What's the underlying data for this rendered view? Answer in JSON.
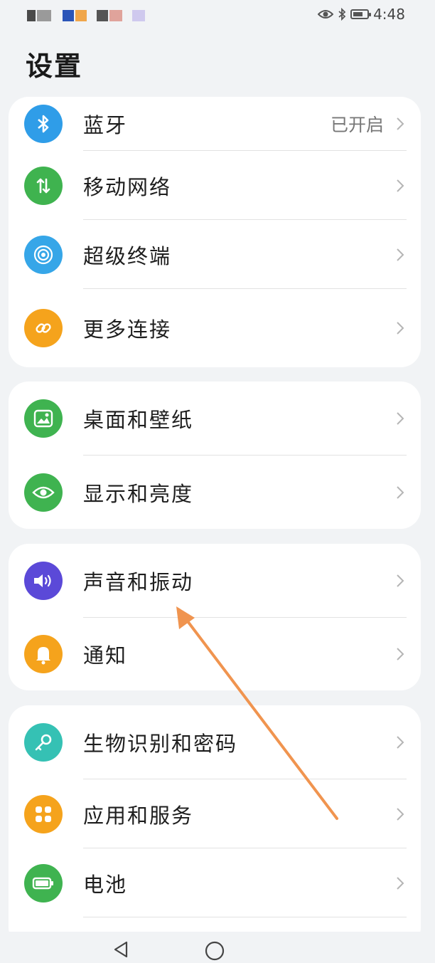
{
  "status_bar": {
    "time": "4:48",
    "icons": [
      "eye-icon",
      "bluetooth-icon",
      "battery-icon"
    ],
    "left_blocks": [
      "#4a4a4a",
      "#8e8e8e",
      "#2b55b8",
      "#f0a64a",
      "#555555",
      "#e0a39b",
      "#cfc9ee"
    ]
  },
  "page": {
    "title": "设置"
  },
  "groups": [
    {
      "items": [
        {
          "label": "蓝牙",
          "value": "已开启",
          "icon": "bluetooth-icon",
          "color": "#2f9de8"
        },
        {
          "label": "移动网络",
          "value": "",
          "icon": "mobile-data-icon",
          "color": "#3fb34f"
        },
        {
          "label": "超级终端",
          "value": "",
          "icon": "super-device-icon",
          "color": "#36a6e8"
        },
        {
          "label": "更多连接",
          "value": "",
          "icon": "link-icon",
          "color": "#f5a31c"
        }
      ]
    },
    {
      "items": [
        {
          "label": "桌面和壁纸",
          "value": "",
          "icon": "wallpaper-icon",
          "color": "#3fb350"
        },
        {
          "label": "显示和亮度",
          "value": "",
          "icon": "eye-icon",
          "color": "#3fb350"
        }
      ]
    },
    {
      "items": [
        {
          "label": "声音和振动",
          "value": "",
          "icon": "sound-icon",
          "color": "#5b49d8"
        },
        {
          "label": "通知",
          "value": "",
          "icon": "bell-icon",
          "color": "#f5a31c"
        }
      ]
    },
    {
      "items": [
        {
          "label": "生物识别和密码",
          "value": "",
          "icon": "key-icon",
          "color": "#35c1b4"
        },
        {
          "label": "应用和服务",
          "value": "",
          "icon": "apps-icon",
          "color": "#f5a31c"
        },
        {
          "label": "电池",
          "value": "",
          "icon": "battery-icon",
          "color": "#3fb350"
        }
      ]
    }
  ],
  "nav": {
    "buttons": [
      "back-icon",
      "home-icon"
    ]
  },
  "colors": {
    "annotation_arrow": "#f0944f"
  }
}
